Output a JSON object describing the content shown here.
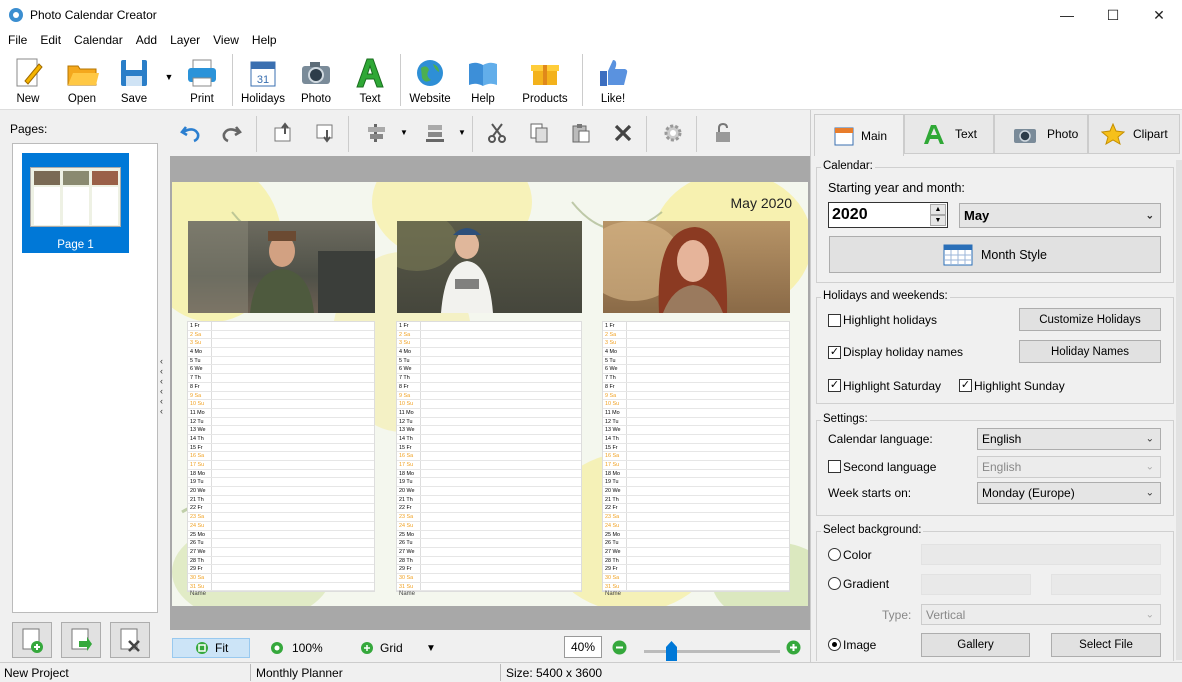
{
  "window": {
    "title": "Photo Calendar Creator"
  },
  "menu": [
    "File",
    "Edit",
    "Calendar",
    "Add",
    "Layer",
    "View",
    "Help"
  ],
  "toolbar": {
    "new": "New",
    "open": "Open",
    "save": "Save",
    "print": "Print",
    "holidays": "Holidays",
    "photo": "Photo",
    "text": "Text",
    "website": "Website",
    "help": "Help",
    "products": "Products",
    "like": "Like!"
  },
  "pages": {
    "label": "Pages:",
    "items": [
      "Page 1"
    ]
  },
  "canvas": {
    "heading": "May 2020",
    "name_label": "Name",
    "days": [
      [
        "1",
        "Fr",
        0
      ],
      [
        "2",
        "Sa",
        1
      ],
      [
        "3",
        "Su",
        1
      ],
      [
        "4",
        "Mo",
        0
      ],
      [
        "5",
        "Tu",
        0
      ],
      [
        "6",
        "We",
        0
      ],
      [
        "7",
        "Th",
        0
      ],
      [
        "8",
        "Fr",
        0
      ],
      [
        "9",
        "Sa",
        1
      ],
      [
        "10",
        "Su",
        1
      ],
      [
        "11",
        "Mo",
        0
      ],
      [
        "12",
        "Tu",
        0
      ],
      [
        "13",
        "We",
        0
      ],
      [
        "14",
        "Th",
        0
      ],
      [
        "15",
        "Fr",
        0
      ],
      [
        "16",
        "Sa",
        1
      ],
      [
        "17",
        "Su",
        1
      ],
      [
        "18",
        "Mo",
        0
      ],
      [
        "19",
        "Tu",
        0
      ],
      [
        "20",
        "We",
        0
      ],
      [
        "21",
        "Th",
        0
      ],
      [
        "22",
        "Fr",
        0
      ],
      [
        "23",
        "Sa",
        1
      ],
      [
        "24",
        "Su",
        1
      ],
      [
        "25",
        "Mo",
        0
      ],
      [
        "26",
        "Tu",
        0
      ],
      [
        "27",
        "We",
        0
      ],
      [
        "28",
        "Th",
        0
      ],
      [
        "29",
        "Fr",
        0
      ],
      [
        "30",
        "Sa",
        1
      ],
      [
        "31",
        "Su",
        1
      ]
    ]
  },
  "bottom": {
    "fit": "Fit",
    "zoom100": "100%",
    "grid": "Grid",
    "zoom": "40%"
  },
  "tabs": {
    "main": "Main",
    "text": "Text",
    "photo": "Photo",
    "clipart": "Clipart"
  },
  "calendar": {
    "group": "Calendar:",
    "start_label": "Starting year and month:",
    "year": "2020",
    "month": "May",
    "month_style": "Month Style"
  },
  "holidays": {
    "group": "Holidays and weekends:",
    "highlight_holidays": "Highlight holidays",
    "customize": "Customize Holidays",
    "display_names": "Display holiday names",
    "holiday_names": "Holiday Names",
    "highlight_saturday": "Highlight Saturday",
    "highlight_sunday": "Highlight Sunday"
  },
  "settings": {
    "group": "Settings:",
    "language_label": "Calendar language:",
    "language": "English",
    "second_language_label": "Second language",
    "second_language": "English",
    "week_label": "Week starts on:",
    "week": "Monday (Europe)"
  },
  "background": {
    "group": "Select background:",
    "color": "Color",
    "gradient": "Gradient",
    "type_label": "Type:",
    "type": "Vertical",
    "image": "Image",
    "gallery": "Gallery",
    "select_file": "Select File"
  },
  "status": {
    "project": "New Project",
    "template": "Monthly Planner",
    "size": "Size: 5400 x 3600"
  }
}
